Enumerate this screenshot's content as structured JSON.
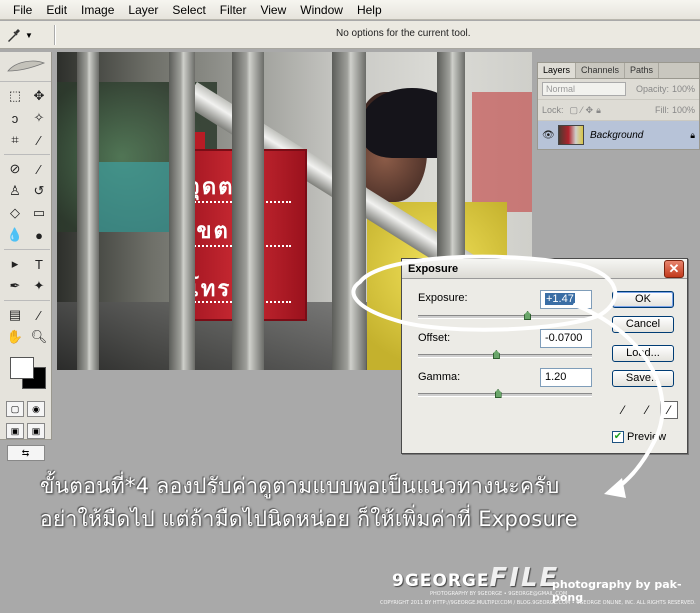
{
  "menu": [
    "File",
    "Edit",
    "Image",
    "Layer",
    "Select",
    "Filter",
    "View",
    "Window",
    "Help"
  ],
  "options_bar": {
    "tool_icon": "eyedropper-icon",
    "message": "No options for the current tool."
  },
  "layers_panel": {
    "tabs": [
      "Layers",
      "Channels",
      "Paths"
    ],
    "blend_mode": "Normal",
    "opacity_label": "Opacity:",
    "opacity_value": "100%",
    "lock_label": "Lock:",
    "fill_label": "Fill:",
    "fill_value": "100%",
    "layer_name": "Background"
  },
  "photo": {
    "sign_line1": "จุดตร",
    "sign_line2": "เขต",
    "sign_line3": "โทร"
  },
  "dialog": {
    "title": "Exposure",
    "exposure_label": "Exposure:",
    "exposure_value": "+1.47",
    "exposure_slider": 0.61,
    "offset_label": "Offset:",
    "offset_value": "-0.0700",
    "offset_slider": 0.43,
    "gamma_label": "Gamma:",
    "gamma_value": "1.20",
    "gamma_slider": 0.44,
    "ok_label": "OK",
    "cancel_label": "Cancel",
    "load_label": "Load...",
    "save_label": "Save...",
    "preview_label": "Preview",
    "preview_checked": true
  },
  "annotation": {
    "line1": "ขั้นตอนที่*4 ลองปรับค่าดูตามแบบพอเป็นแนวทางนะครับ",
    "line2": "อย่าให้มืดไป แต่ถ้ามืดไปนิดหน่อย ก็ให้เพิ่มค่าที่ Exposure",
    "brand_left": "9GEORGE",
    "brand_file": "FILE",
    "brand_right": "photography by pak-pong",
    "fine1": "PHOTOGRAPHY BY 9GEORGE • 9GEORGE@GMAIL.COM",
    "fine2": "COPYRIGHT 2011 BY HTTP://9GEORGE.MULTIPLY.COM / BLOG.9GEORGE.COM • 9GEORGE ONLINE, INC. ALL RIGHTS RESERVED."
  },
  "colors": {
    "menubar": "#ece9d8",
    "accent_selected_layer": "#b7c3d8",
    "annotation_text": "#ffffff",
    "sign_red": "#c92a33"
  }
}
